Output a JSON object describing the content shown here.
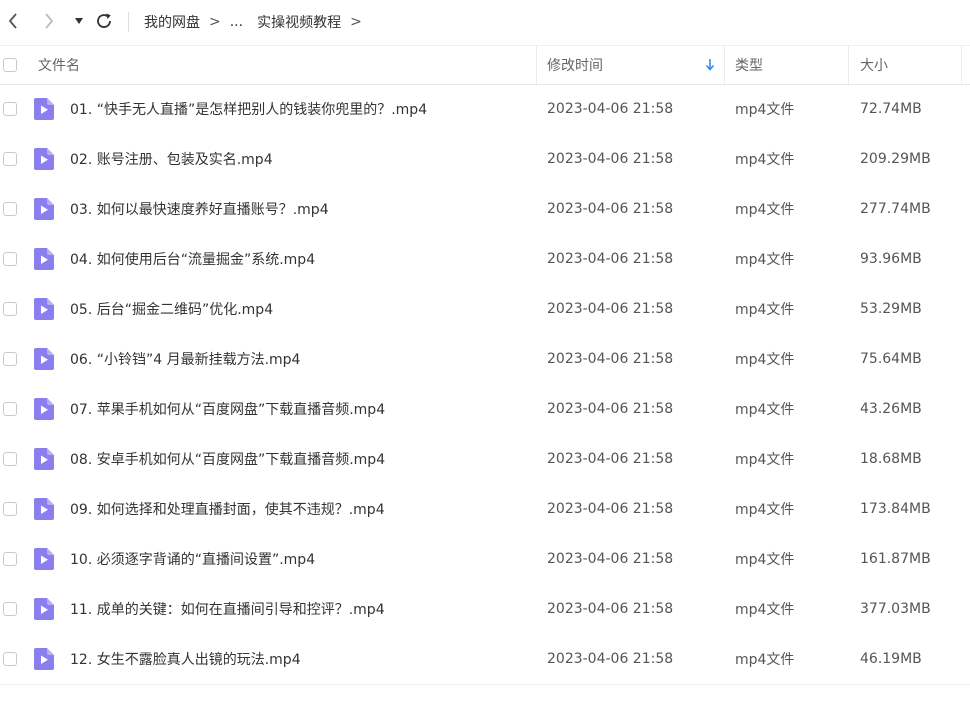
{
  "toolbar": {
    "back_icon": "chevron-left-icon",
    "forward_icon": "chevron-right-icon",
    "dropdown_icon": "caret-down-icon",
    "refresh_icon": "refresh-icon"
  },
  "breadcrumb": {
    "items": [
      "我的网盘",
      "...",
      "实操视频教程"
    ],
    "separator": ">"
  },
  "columns": {
    "name": "文件名",
    "modified": "修改时间",
    "type": "类型",
    "size": "大小"
  },
  "sort": {
    "column": "修改时间",
    "direction": "descending",
    "icon": "sort-down-arrow-icon"
  },
  "colors": {
    "accent": "#2d8cf0",
    "file_icon": "#8b7ff0",
    "text": "#333333",
    "muted": "#666666"
  },
  "files": [
    {
      "name": "01. “快手无人直播”是怎样把别人的钱装你兜里的？.mp4",
      "modified": "2023-04-06 21:58",
      "type": "mp4文件",
      "size": "72.74MB"
    },
    {
      "name": "02. 账号注册、包装及实名.mp4",
      "modified": "2023-04-06 21:58",
      "type": "mp4文件",
      "size": "209.29MB"
    },
    {
      "name": "03. 如何以最快速度养好直播账号？.mp4",
      "modified": "2023-04-06 21:58",
      "type": "mp4文件",
      "size": "277.74MB"
    },
    {
      "name": "04. 如何使用后台“流量掘金”系统.mp4",
      "modified": "2023-04-06 21:58",
      "type": "mp4文件",
      "size": "93.96MB"
    },
    {
      "name": "05. 后台“掘金二维码”优化.mp4",
      "modified": "2023-04-06 21:58",
      "type": "mp4文件",
      "size": "53.29MB"
    },
    {
      "name": "06. “小铃铛”4 月最新挂载方法.mp4",
      "modified": "2023-04-06 21:58",
      "type": "mp4文件",
      "size": "75.64MB"
    },
    {
      "name": "07. 苹果手机如何从“百度网盘”下载直播音频.mp4",
      "modified": "2023-04-06 21:58",
      "type": "mp4文件",
      "size": "43.26MB"
    },
    {
      "name": "08. 安卓手机如何从“百度网盘”下载直播音频.mp4",
      "modified": "2023-04-06 21:58",
      "type": "mp4文件",
      "size": "18.68MB"
    },
    {
      "name": "09. 如何选择和处理直播封面，使其不违规？.mp4",
      "modified": "2023-04-06 21:58",
      "type": "mp4文件",
      "size": "173.84MB"
    },
    {
      "name": "10. 必须逐字背诵的“直播间设置”.mp4",
      "modified": "2023-04-06 21:58",
      "type": "mp4文件",
      "size": "161.87MB"
    },
    {
      "name": "11. 成单的关键：如何在直播间引导和控评？.mp4",
      "modified": "2023-04-06 21:58",
      "type": "mp4文件",
      "size": "377.03MB"
    },
    {
      "name": "12. 女生不露脸真人出镜的玩法.mp4",
      "modified": "2023-04-06 21:58",
      "type": "mp4文件",
      "size": "46.19MB"
    }
  ]
}
